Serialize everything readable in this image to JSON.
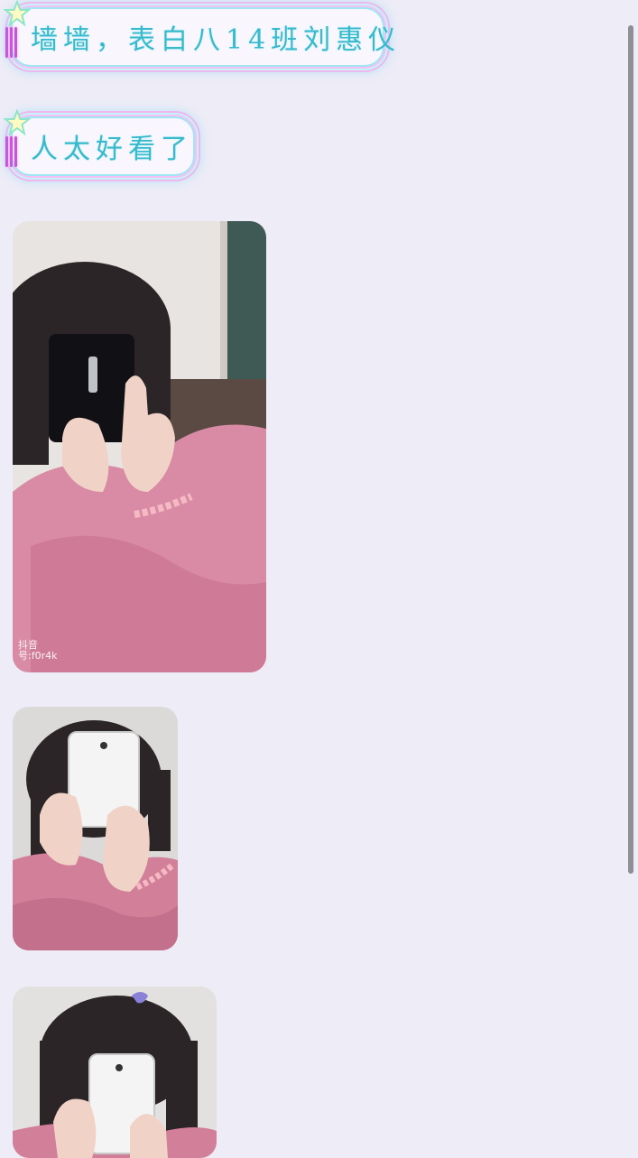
{
  "messages": [
    {
      "type": "text",
      "text": "墙墙，表白八14班刘惠仪"
    },
    {
      "type": "text",
      "text": "人太好看了"
    },
    {
      "type": "image",
      "content": "selfie-photo-pink-pajamas-phone-covering-face",
      "caption_line1": "抖音",
      "caption_line2": "号:f0r4k"
    },
    {
      "type": "image",
      "content": "selfie-photo-holding-white-phone-mirror"
    },
    {
      "type": "image",
      "content": "selfie-photo-holding-white-phone-mirror-partial"
    }
  ],
  "colors": {
    "background": "#edecf7",
    "bubble_text": "#38b9cc",
    "bubble_border_cyan": "#9fe6f2",
    "bubble_border_pink": "#efb6ef"
  }
}
